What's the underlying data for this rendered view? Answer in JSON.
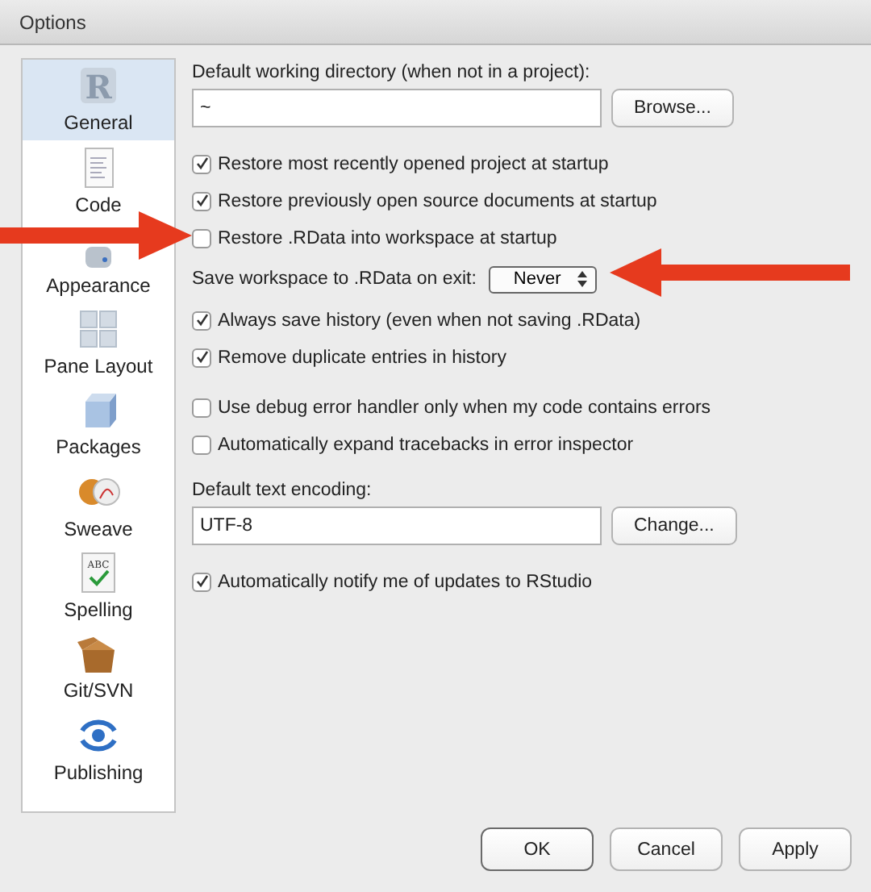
{
  "window": {
    "title": "Options"
  },
  "sidebar": {
    "items": [
      {
        "label": "General",
        "selected": true,
        "icon_text": "R"
      },
      {
        "label": "Code",
        "selected": false
      },
      {
        "label": "Appearance",
        "selected": false
      },
      {
        "label": "Pane Layout",
        "selected": false
      },
      {
        "label": "Packages",
        "selected": false
      },
      {
        "label": "Sweave",
        "selected": false
      },
      {
        "label": "Spelling",
        "selected": false,
        "icon_text": "ABC"
      },
      {
        "label": "Git/SVN",
        "selected": false
      },
      {
        "label": "Publishing",
        "selected": false
      }
    ]
  },
  "sections": [
    [
      {
        "kind": "field",
        "label": "Default working directory (when not in a project):",
        "value": "~",
        "button": "Browse..."
      }
    ],
    [
      {
        "kind": "checkbox",
        "label": "Restore most recently opened project at startup",
        "checked": true
      },
      {
        "kind": "checkbox",
        "label": "Restore previously open source documents at startup",
        "checked": true
      },
      {
        "kind": "checkbox",
        "label": "Restore .RData into workspace at startup",
        "checked": false
      },
      {
        "kind": "select",
        "label": "Save workspace to .RData on exit:",
        "value": "Never"
      },
      {
        "kind": "checkbox",
        "label": "Always save history (even when not saving .RData)",
        "checked": true
      },
      {
        "kind": "checkbox",
        "label": "Remove duplicate entries in history",
        "checked": true
      }
    ],
    [
      {
        "kind": "checkbox",
        "label": "Use debug error handler only when my code contains errors",
        "checked": false
      },
      {
        "kind": "checkbox",
        "label": "Automatically expand tracebacks in error inspector",
        "checked": false
      }
    ],
    [
      {
        "kind": "field",
        "label": "Default text encoding:",
        "value": "UTF-8",
        "button": "Change..."
      }
    ],
    [
      {
        "kind": "checkbox",
        "label": "Automatically notify me of updates to RStudio",
        "checked": true
      }
    ]
  ],
  "buttons": [
    {
      "label": "OK",
      "default": true
    },
    {
      "label": "Cancel",
      "default": false
    },
    {
      "label": "Apply",
      "default": false
    }
  ]
}
